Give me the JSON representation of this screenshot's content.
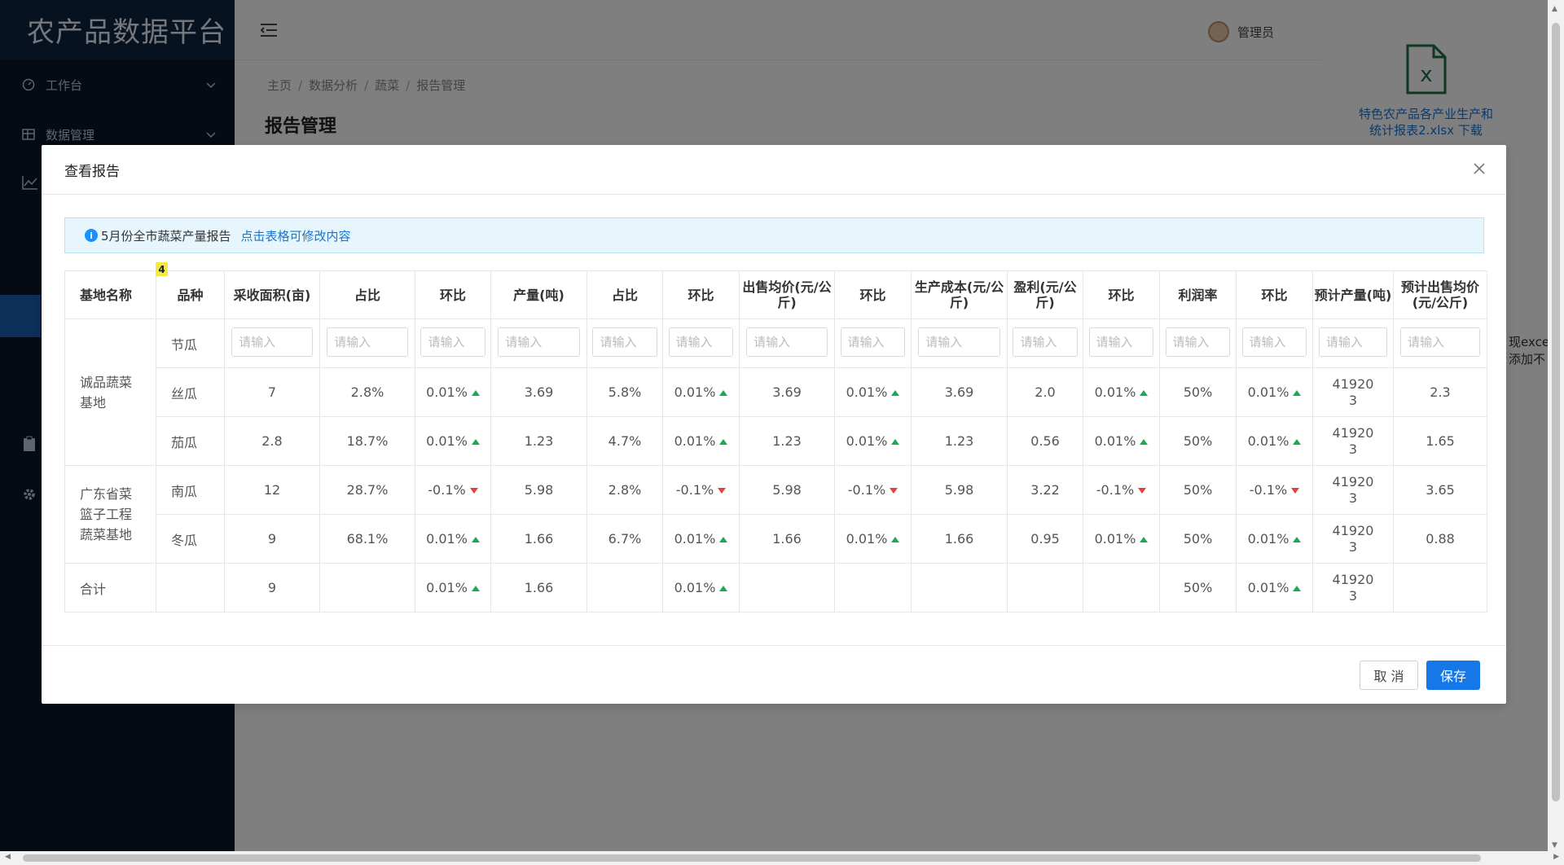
{
  "app": {
    "title": "农产品数据平台"
  },
  "sidebar": {
    "items": [
      {
        "label": "工作台",
        "icon": "dashboard-icon"
      },
      {
        "label": "数据管理",
        "icon": "table-icon"
      }
    ]
  },
  "header": {
    "user": "管理员"
  },
  "breadcrumb": [
    "主页",
    "数据分析",
    "蔬菜",
    "报告管理"
  ],
  "page": {
    "title": "报告管理"
  },
  "right_panel": {
    "file_name": "特色农产品各产业生产和统计报表2.xlsx",
    "file_link_tail": "下载",
    "note_line1": "现exce",
    "note_line2": "添加不"
  },
  "dialog": {
    "title": "查看报告",
    "alert_text": "5月份全市蔬菜产量报告",
    "alert_hint": "点击表格可修改内容",
    "alert_icon": "info-icon",
    "badge": "4",
    "columns": [
      "基地名称",
      "品种",
      "采收面积(亩)",
      "占比",
      "环比",
      "产量(吨)",
      "占比",
      "环比",
      "出售均价(元/公斤)",
      "环比",
      "生产成本(元/公斤)",
      "盈利(元/公斤)",
      "环比",
      "利润率",
      "环比",
      "预计产量(吨)",
      "预计出售均价(元/公斤)"
    ],
    "placeholder": "请输入",
    "groups": [
      {
        "name": "诚品蔬菜基地",
        "rows": [
          {
            "variety": "节瓜",
            "editable": true
          },
          {
            "variety": "丝瓜",
            "area": "7",
            "area_pct": "2.8%",
            "area_mom": "0.01%",
            "area_dir": "up",
            "output": "3.69",
            "output_pct": "5.8%",
            "output_mom": "0.01%",
            "output_dir": "up",
            "price": "3.69",
            "price_mom": "0.01%",
            "price_dir": "up",
            "cost": "3.69",
            "profit": "2.0",
            "profit_mom": "0.01%",
            "profit_dir": "up",
            "margin": "50%",
            "margin_mom": "0.01%",
            "margin_dir": "up",
            "expected_output": "419203",
            "expected_price": "2.3"
          },
          {
            "variety": "茄瓜",
            "area": "2.8",
            "area_pct": "18.7%",
            "area_mom": "0.01%",
            "area_dir": "up",
            "output": "1.23",
            "output_pct": "4.7%",
            "output_mom": "0.01%",
            "output_dir": "up",
            "price": "1.23",
            "price_mom": "0.01%",
            "price_dir": "up",
            "cost": "1.23",
            "profit": "0.56",
            "profit_mom": "0.01%",
            "profit_dir": "up",
            "margin": "50%",
            "margin_mom": "0.01%",
            "margin_dir": "up",
            "expected_output": "419203",
            "expected_price": "1.65"
          }
        ]
      },
      {
        "name": "广东省菜篮子工程蔬菜基地",
        "rows": [
          {
            "variety": "南瓜",
            "area": "12",
            "area_pct": "28.7%",
            "area_mom": "-0.1%",
            "area_dir": "down",
            "output": "5.98",
            "output_pct": "2.8%",
            "output_mom": "-0.1%",
            "output_dir": "down",
            "price": "5.98",
            "price_mom": "-0.1%",
            "price_dir": "down",
            "cost": "5.98",
            "profit": "3.22",
            "profit_mom": "-0.1%",
            "profit_dir": "down",
            "margin": "50%",
            "margin_mom": "-0.1%",
            "margin_dir": "down",
            "expected_output": "419203",
            "expected_price": "3.65"
          },
          {
            "variety": "冬瓜",
            "area": "9",
            "area_pct": "68.1%",
            "area_mom": "0.01%",
            "area_dir": "up",
            "output": "1.66",
            "output_pct": "6.7%",
            "output_mom": "0.01%",
            "output_dir": "up",
            "price": "1.66",
            "price_mom": "0.01%",
            "price_dir": "up",
            "cost": "1.66",
            "profit": "0.95",
            "profit_mom": "0.01%",
            "profit_dir": "up",
            "margin": "50%",
            "margin_mom": "0.01%",
            "margin_dir": "up",
            "expected_output": "419203",
            "expected_price": "0.88"
          }
        ]
      }
    ],
    "total": {
      "label": "合计",
      "area": "9",
      "area_mom": "0.01%",
      "output": "1.66",
      "output_mom": "0.01%",
      "margin": "50%",
      "margin_mom": "0.01%",
      "expected_output": "419203"
    },
    "cancel_label": "取 消",
    "save_label": "保存"
  },
  "colors": {
    "sidebar": "#0d1526",
    "logo_bg": "#0f2542",
    "primary": "#1677e8",
    "up": "#1aaa55",
    "down": "#e83e3e"
  }
}
